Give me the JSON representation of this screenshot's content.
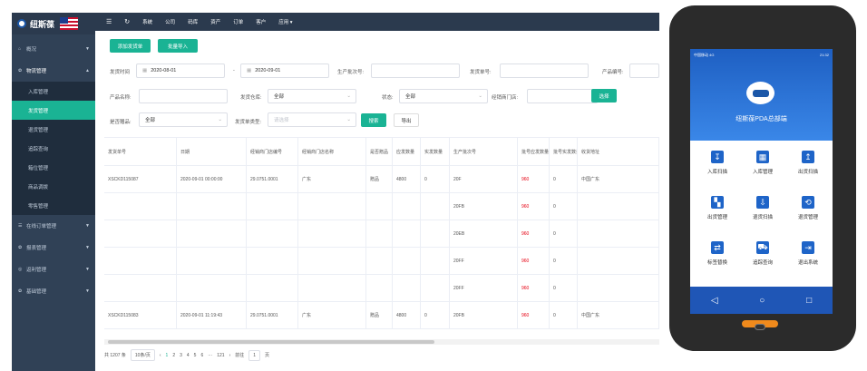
{
  "sidebar": {
    "logo_text": "纽斯葆",
    "items": [
      {
        "label": "概况",
        "icon": "home-icon"
      },
      {
        "label": "物流管理",
        "icon": "gear-icon",
        "expanded": true
      },
      {
        "label": "在线订单管理",
        "icon": "doc-icon"
      },
      {
        "label": "报表管理",
        "icon": "gear-icon"
      },
      {
        "label": "返利管理",
        "icon": "money-icon"
      },
      {
        "label": "基础管理",
        "icon": "gear-icon"
      }
    ],
    "sub": [
      "入库管理",
      "发货管理",
      "退货管理",
      "追踪查询",
      "箱位管理",
      "商品调拨",
      "零售管理"
    ]
  },
  "topnav": [
    "系统",
    "公司",
    "码库",
    "资产",
    "订单",
    "客户",
    "应用 ▾"
  ],
  "buttons": {
    "add": "添加发货单",
    "import": "批量导入",
    "select": "选择",
    "search": "搜索",
    "export": "导出"
  },
  "filters": {
    "ship_time": "发货时间",
    "date_from": "2020-08-01",
    "date_sep": "-",
    "date_to": "2020-09-01",
    "batch": "生产批次号:",
    "ship_no": "发货单号:",
    "prod_no": "产品编号:",
    "prod_name": "产品名称:",
    "warehouse": "发货仓库:",
    "warehouse_val": "全部",
    "status": "状态:",
    "status_val": "全部",
    "dealer": "经销商门店:",
    "gift": "是否赠品:",
    "gift_val": "全部",
    "type": "发货单类型:",
    "type_ph": "请选择"
  },
  "table": {
    "headers": [
      "发货单号",
      "日期",
      "经销商门店编号",
      "经销商门店名称",
      "是否赠品",
      "应发数量",
      "实发数量",
      "生产批次号",
      "批号应发数量",
      "批号实发数量",
      "收货地址"
    ],
    "rows": [
      {
        "no": "XSCKD115087",
        "date": "2020-09-01 00:00:00",
        "code": "29.0751.0001",
        "name": "广东",
        "gift": "赠品",
        "plan": "4800",
        "real": "0",
        "batch": "20F",
        "bplan": "960",
        "breal": "0",
        "addr": "中国广东"
      },
      {
        "no": "",
        "date": "",
        "code": "",
        "name": "",
        "gift": "",
        "plan": "",
        "real": "",
        "batch": "20FB",
        "bplan": "960",
        "breal": "0",
        "addr": ""
      },
      {
        "no": "",
        "date": "",
        "code": "",
        "name": "",
        "gift": "",
        "plan": "",
        "real": "",
        "batch": "20EB",
        "bplan": "960",
        "breal": "0",
        "addr": ""
      },
      {
        "no": "",
        "date": "",
        "code": "",
        "name": "",
        "gift": "",
        "plan": "",
        "real": "",
        "batch": "20FF",
        "bplan": "960",
        "breal": "0",
        "addr": ""
      },
      {
        "no": "",
        "date": "",
        "code": "",
        "name": "",
        "gift": "",
        "plan": "",
        "real": "",
        "batch": "20FF",
        "bplan": "960",
        "breal": "0",
        "addr": ""
      },
      {
        "no": "XSCKD115083",
        "date": "2020-09-01 11:19:43",
        "code": "29.0751.0001",
        "name": "广东",
        "gift": "赠品",
        "plan": "4800",
        "real": "0",
        "batch": "20FB",
        "bplan": "960",
        "breal": "0",
        "addr": "中国广东"
      }
    ]
  },
  "pager": {
    "total": "共 1207 条",
    "size": "10条/页",
    "pages": [
      "1",
      "2",
      "3",
      "4",
      "5",
      "6",
      "···",
      "121"
    ],
    "goto": "前往",
    "page": "1",
    "unit": "页"
  },
  "pda": {
    "title": "纽斯葆PDA总部端",
    "status_left": "中国移动 4G",
    "status_right": "21:32",
    "grid": [
      {
        "label": "入库扫描",
        "icon": "scan-in-icon"
      },
      {
        "label": "入库管理",
        "icon": "warehouse-icon"
      },
      {
        "label": "出货扫描",
        "icon": "scan-out-icon"
      },
      {
        "label": "出货管理",
        "icon": "grid-icon"
      },
      {
        "label": "退货扫描",
        "icon": "return-scan-icon"
      },
      {
        "label": "退货管理",
        "icon": "return-manage-icon"
      },
      {
        "label": "标签替换",
        "icon": "replace-icon"
      },
      {
        "label": "追踪查询",
        "icon": "truck-icon"
      },
      {
        "label": "退出系统",
        "icon": "exit-icon"
      }
    ],
    "nav": [
      "◁",
      "○",
      "□"
    ]
  }
}
